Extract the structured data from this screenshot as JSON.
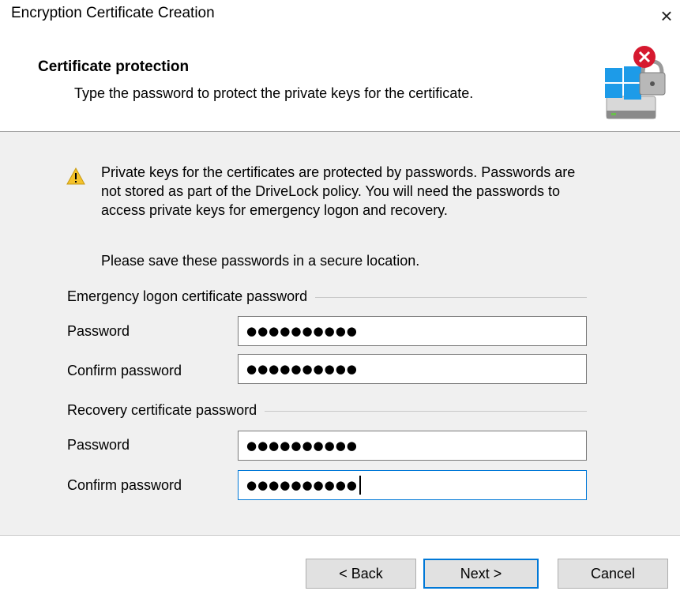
{
  "window": {
    "title": "Encryption Certificate Creation",
    "close_glyph": "×"
  },
  "header": {
    "title": "Certificate protection",
    "subtitle": "Type the password to protect the private keys for the certificate.",
    "icon": "drivelock-encryption-icon"
  },
  "notice": {
    "icon": "warning-icon",
    "text": "Private keys for the certificates are protected by passwords. Passwords are not stored as part of the DriveLock policy. You will need the passwords to access private keys for emergency logon and recovery.",
    "save_hint": "Please save these passwords in a secure location."
  },
  "emergency": {
    "legend": "Emergency logon certificate password",
    "password_label": "Password",
    "password_value": "●●●●●●●●●●",
    "confirm_label": "Confirm password",
    "confirm_value": "●●●●●●●●●●"
  },
  "recovery": {
    "legend": "Recovery certificate password",
    "password_label": "Password",
    "password_value": "●●●●●●●●●●",
    "confirm_label": "Confirm password",
    "confirm_value": "●●●●●●●●●●"
  },
  "buttons": {
    "back": "< Back",
    "next": "Next >",
    "cancel": "Cancel"
  },
  "colors": {
    "focus_border": "#0078d7",
    "dialog_body": "#f0f0f0",
    "warning": "#f4c22b"
  }
}
